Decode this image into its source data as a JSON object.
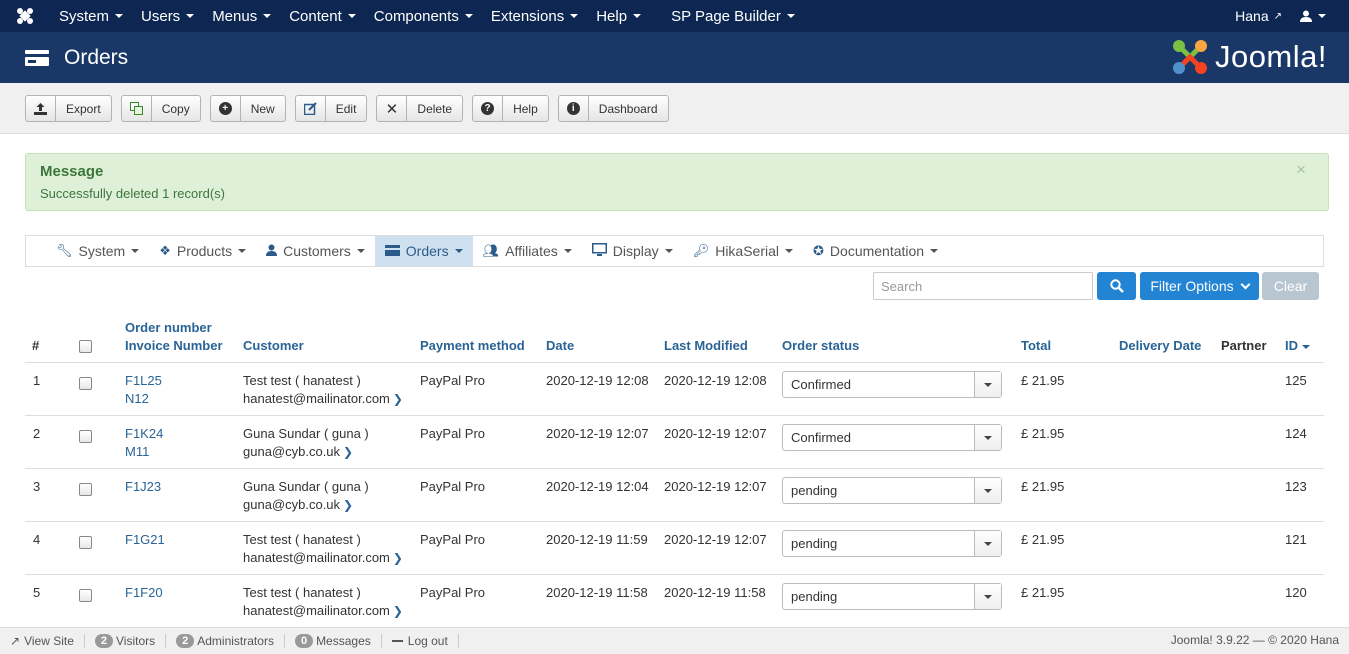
{
  "topnav": {
    "items": [
      "System",
      "Users",
      "Menus",
      "Content",
      "Components",
      "Extensions",
      "Help",
      "SP Page Builder"
    ],
    "user": "Hana"
  },
  "header": {
    "title": "Orders",
    "brand": "Joomla!"
  },
  "toolbar": {
    "export": "Export",
    "copy": "Copy",
    "new": "New",
    "edit": "Edit",
    "delete": "Delete",
    "help": "Help",
    "dashboard": "Dashboard"
  },
  "message": {
    "title": "Message",
    "body": "Successfully deleted 1 record(s)",
    "close": "×"
  },
  "hikamenu": {
    "items": [
      "System",
      "Products",
      "Customers",
      "Orders",
      "Affiliates",
      "Display",
      "HikaSerial",
      "Documentation"
    ]
  },
  "filter": {
    "search_placeholder": "Search",
    "filter_options": "Filter Options",
    "clear": "Clear"
  },
  "table": {
    "headers": {
      "num": "#",
      "order_number": "Order number",
      "invoice_number": "Invoice Number",
      "customer": "Customer",
      "payment": "Payment method",
      "date": "Date",
      "modified": "Last Modified",
      "status": "Order status",
      "total": "Total",
      "delivery": "Delivery Date",
      "partner": "Partner",
      "id": "ID"
    },
    "rows": [
      {
        "num": "1",
        "order": "F1L25",
        "invoice": "N12",
        "cust_name": "Test test ( hanatest )",
        "cust_email": "hanatest@mailinator.com",
        "payment": "PayPal Pro",
        "date": "2020-12-19 12:08",
        "modified": "2020-12-19 12:08",
        "status": "Confirmed",
        "total": "£ 21.95",
        "id": "125"
      },
      {
        "num": "2",
        "order": "F1K24",
        "invoice": "M11",
        "cust_name": "Guna Sundar ( guna )",
        "cust_email": "guna@cyb.co.uk",
        "payment": "PayPal Pro",
        "date": "2020-12-19 12:07",
        "modified": "2020-12-19 12:07",
        "status": "Confirmed",
        "total": "£ 21.95",
        "id": "124"
      },
      {
        "num": "3",
        "order": "F1J23",
        "invoice": "",
        "cust_name": "Guna Sundar ( guna )",
        "cust_email": "guna@cyb.co.uk",
        "payment": "PayPal Pro",
        "date": "2020-12-19 12:04",
        "modified": "2020-12-19 12:07",
        "status": "pending",
        "total": "£ 21.95",
        "id": "123"
      },
      {
        "num": "4",
        "order": "F1G21",
        "invoice": "",
        "cust_name": "Test test ( hanatest )",
        "cust_email": "hanatest@mailinator.com",
        "payment": "PayPal Pro",
        "date": "2020-12-19 11:59",
        "modified": "2020-12-19 12:07",
        "status": "pending",
        "total": "£ 21.95",
        "id": "121"
      },
      {
        "num": "5",
        "order": "F1F20",
        "invoice": "",
        "cust_name": "Test test ( hanatest )",
        "cust_email": "hanatest@mailinator.com",
        "payment": "PayPal Pro",
        "date": "2020-12-19 11:58",
        "modified": "2020-12-19 11:58",
        "status": "pending",
        "total": "£ 21.95",
        "id": "120"
      }
    ]
  },
  "footer": {
    "view_site": "View Site",
    "visitors_count": "2",
    "visitors": "Visitors",
    "admins_count": "2",
    "admins": "Administrators",
    "messages_count": "0",
    "messages": "Messages",
    "logout": "Log out",
    "version": "Joomla! 3.9.22 — © 2020 Hana"
  },
  "colors": {
    "navbar": "#0d2752",
    "header": "#1a3867",
    "primary": "#2384d3",
    "success_bg": "#dff0d8",
    "link": "#2a6496"
  }
}
